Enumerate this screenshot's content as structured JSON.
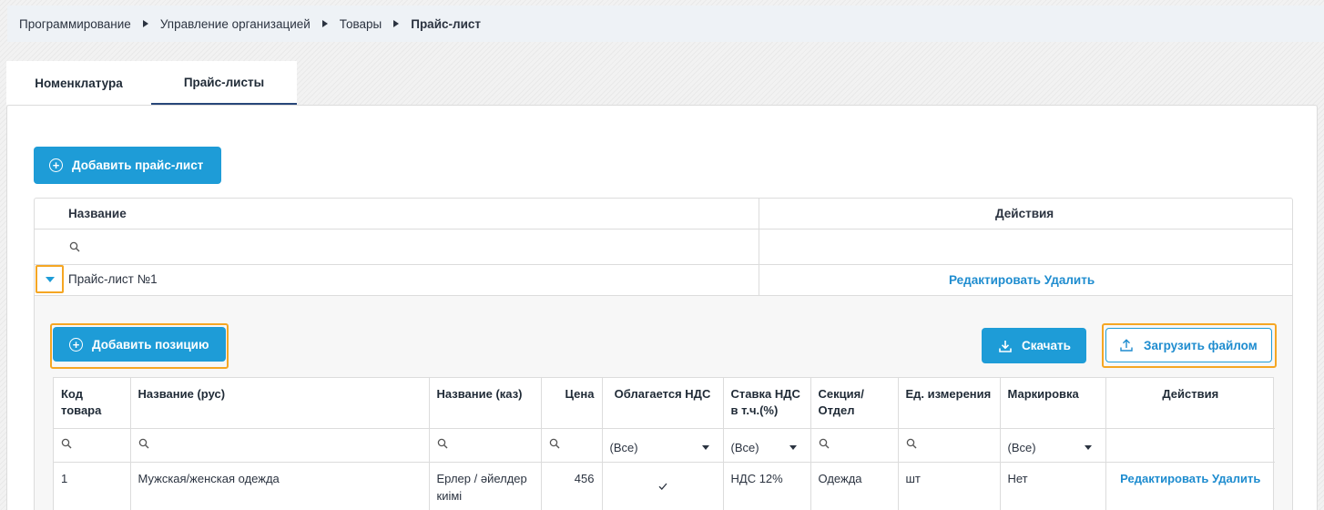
{
  "breadcrumb": [
    "Программирование",
    "Управление организацией",
    "Товары",
    "Прайс-лист"
  ],
  "tabs": [
    {
      "label": "Номенклатура",
      "active": false
    },
    {
      "label": "Прайс-листы",
      "active": true
    }
  ],
  "add_price_list_label": "Добавить прайс-лист",
  "price_grid": {
    "columns": [
      "Название",
      "Действия"
    ],
    "search_value": "",
    "rows": [
      {
        "name": "Прайс-лист №1",
        "edit": "Редактировать",
        "delete": "Удалить",
        "expanded": true
      }
    ]
  },
  "detail": {
    "add_position_label": "Добавить позицию",
    "download_label": "Скачать",
    "upload_label": "Загрузить файлом",
    "columns": [
      "Код товара",
      "Название (рус)",
      "Название (каз)",
      "Цена",
      "Облагается НДС",
      "Ставка НДС в т.ч.(%)",
      "Секция/ Отдел",
      "Ед. измерения",
      "Маркировка",
      "Действия"
    ],
    "filters": {
      "vat": "(Все)",
      "vat_rate": "(Все)",
      "marking": "(Все)"
    },
    "rows": [
      {
        "code": "1",
        "name_ru": "Мужская/женская одежда",
        "name_kz": "Ерлер / әйелдер киімі",
        "price": "456",
        "vat": true,
        "vat_rate": "НДС 12%",
        "section": "Одежда",
        "unit": "шт",
        "marking": "Нет",
        "edit": "Редактировать",
        "delete": "Удалить"
      }
    ]
  },
  "colors": {
    "accent": "#1e9cd7",
    "highlight": "#f5a623",
    "tab_underline": "#28477a"
  }
}
